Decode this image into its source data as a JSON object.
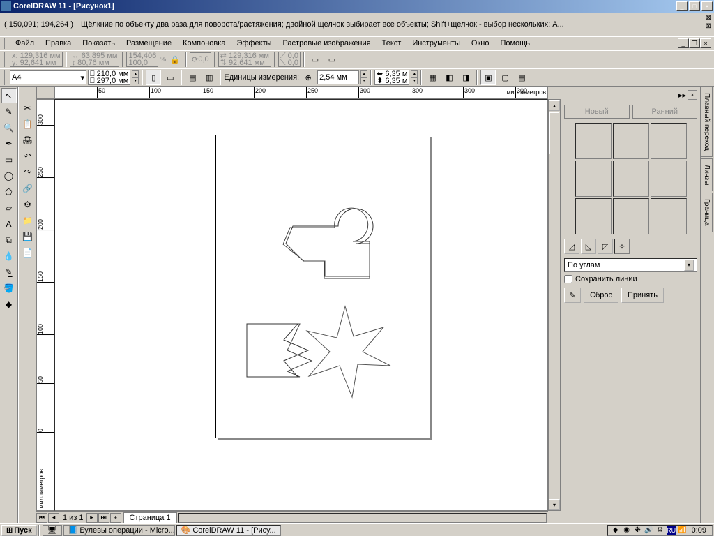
{
  "window": {
    "title": "CorelDRAW 11 - [Рисунок1]"
  },
  "status": {
    "coords": "( 150,091; 194,264 )",
    "hint": "Щёлкние по объекту два раза для поворота/растяжения; двойной щелчок выбирает все объекты; Shift+щелчок - выбор нескольких; A..."
  },
  "menu": {
    "items": [
      "Файл",
      "Правка",
      "Показать",
      "Размещение",
      "Компоновка",
      "Эффекты",
      "Растровые изображения",
      "Текст",
      "Инструменты",
      "Окно",
      "Помощь"
    ]
  },
  "propbar1": {
    "x": "129,316 мм",
    "y": "92,641 мм",
    "w": "63,895 мм",
    "h": "80,76 мм",
    "sx": "154,406",
    "sy": "100,0",
    "rot": "0,0",
    "mx": "129,316 мм",
    "my": "92,641 мм",
    "px": "0,0",
    "py": "0,0"
  },
  "propbar2": {
    "paper": "A4",
    "pw": "210,0 мм",
    "ph": "297,0 мм",
    "units_label": "Единицы измерения:",
    "step": "2,54 мм",
    "nudge1": "6,35 м",
    "nudge2": "6,35 м"
  },
  "ruler": {
    "h_ticks": [
      "50",
      "100",
      "150",
      "200",
      "250",
      "300"
    ],
    "v_ticks": [
      "300",
      "250",
      "200",
      "150",
      "100",
      "50",
      "0"
    ],
    "unit_h": "миллиметров",
    "unit_v": "миллиметров"
  },
  "nav": {
    "page_of": "1 из 1",
    "tab": "Страница 1"
  },
  "docker": {
    "new": "Новый",
    "earlier": "Ранний",
    "mode": "По углам",
    "save_lines": "Сохранить линии",
    "reset": "Сброс",
    "apply": "Принять",
    "tabs": [
      "Плавный переход",
      "Линзы",
      "Граница"
    ]
  },
  "taskbar": {
    "start": "Пуск",
    "tasks": [
      "Булевы операции - Micro...",
      "CorelDRAW 11 - [Рису..."
    ],
    "lang": "RU",
    "clock": "0:09"
  }
}
